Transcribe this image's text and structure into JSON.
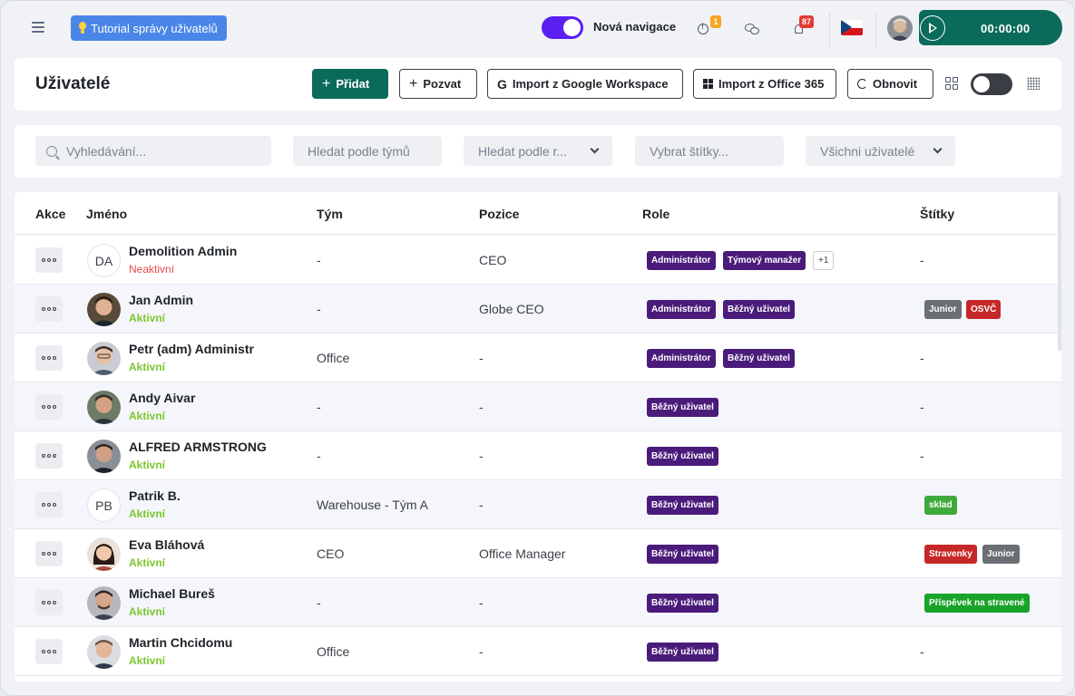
{
  "topbar": {
    "tutorial_label": "Tutorial správy uživatelů",
    "new_nav_label": "Nová navigace",
    "alert_count": "1",
    "notification_count": "87",
    "timer": "00:00:00"
  },
  "header": {
    "title": "Uživatelé",
    "add_label": "Přidat",
    "invite_label": "Pozvat",
    "google_label": "Import z Google Workspace",
    "office_label": "Import z Office 365",
    "refresh_label": "Obnovit"
  },
  "filters": {
    "search_placeholder": "Vyhledávání...",
    "team_placeholder": "Hledat podle týmů",
    "role_placeholder": "Hledat podle r...",
    "tags_placeholder": "Vybrat štítky...",
    "users_select": "Všichni uživatelé"
  },
  "table": {
    "headers": {
      "actions": "Akce",
      "name": "Jméno",
      "team": "Tým",
      "position": "Pozice",
      "role": "Role",
      "tags": "Štítky"
    },
    "rows": [
      {
        "initials": "DA",
        "name": "Demolition Admin",
        "status": "Neaktivní",
        "team": "-",
        "position": "CEO",
        "roles": [
          "Administrátor",
          "Týmový manažer"
        ],
        "roles_more": "+1",
        "tags": [],
        "tags_empty": "-"
      },
      {
        "name": "Jan Admin",
        "status": "Aktivní",
        "team": "-",
        "position": "Globe CEO",
        "roles": [
          "Administrátor",
          "Běžný uživatel"
        ],
        "tags": [
          "Junior",
          "OSVČ"
        ]
      },
      {
        "name": "Petr (adm) Administr",
        "status": "Aktivní",
        "team": "Office",
        "position": "-",
        "roles": [
          "Administrátor",
          "Běžný uživatel"
        ],
        "tags": [],
        "tags_empty": "-"
      },
      {
        "name": "Andy Aivar",
        "status": "Aktivní",
        "team": "-",
        "position": "-",
        "roles": [
          "Běžný uživatel"
        ],
        "tags": [],
        "tags_empty": "-"
      },
      {
        "name": "ALFRED ARMSTRONG",
        "status": "Aktivní",
        "team": "-",
        "position": "-",
        "roles": [
          "Běžný uživatel"
        ],
        "tags": [],
        "tags_empty": "-"
      },
      {
        "initials": "PB",
        "name": "Patrik B.",
        "status": "Aktivní",
        "team": "Warehouse - Tým A",
        "position": "-",
        "roles": [
          "Běžný uživatel"
        ],
        "tags": [
          "sklad"
        ]
      },
      {
        "name": "Eva Bláhová",
        "status": "Aktivní",
        "team": "CEO",
        "position": "Office Manager",
        "roles": [
          "Běžný uživatel"
        ],
        "tags": [
          "Stravenky",
          "Junior"
        ]
      },
      {
        "name": "Michael Bureš",
        "status": "Aktivní",
        "team": "-",
        "position": "-",
        "roles": [
          "Běžný uživatel"
        ],
        "tags": [
          "Příspěvek na stravené"
        ]
      },
      {
        "name": "Martin Chcidomu",
        "status": "Aktivní",
        "team": "Office",
        "position": "-",
        "roles": [
          "Běžný uživatel"
        ],
        "tags": [],
        "tags_empty": "-"
      }
    ]
  },
  "colors": {
    "brand": "#0b6b5b",
    "nav_toggle": "#5b1ff2",
    "role_badge": "#4a1b7a",
    "active": "#7cc62e",
    "inactive": "#e84a4a"
  }
}
